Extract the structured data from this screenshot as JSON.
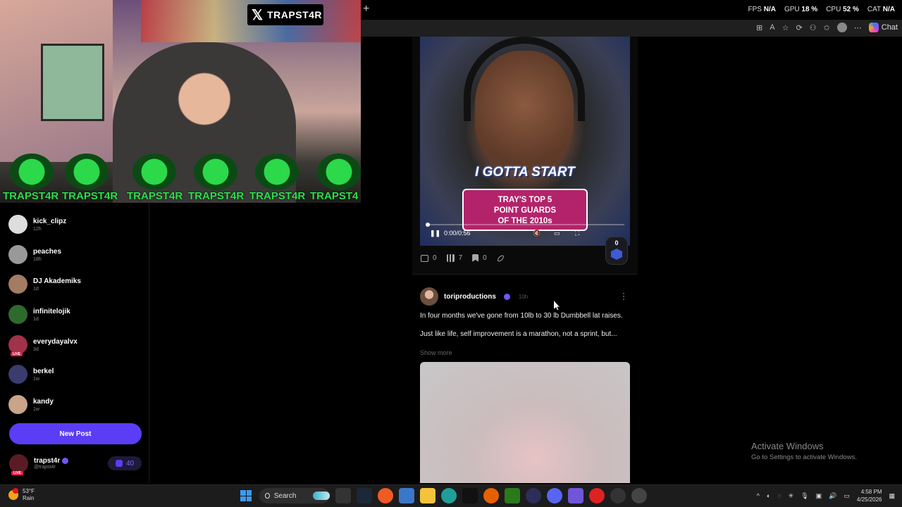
{
  "webcam": {
    "badge_text": "TRAPST4R",
    "tags": [
      "TRAPST4R",
      "TRAPST4R",
      "TRAPST4R",
      "TRAPST4R",
      "TRAPST4R",
      "TRAPST4"
    ]
  },
  "perf": {
    "fps_label": "FPS",
    "fps_value": "N/A",
    "gpu_label": "GPU",
    "gpu_value": "18 %",
    "cpu_label": "CPU",
    "cpu_value": "52 %",
    "cat_label": "CAT",
    "cat_value": "N/A"
  },
  "browser": {
    "chat_label": "Chat",
    "new_tab": "+"
  },
  "sidebar": {
    "users": [
      {
        "name": "kick_clipz",
        "ago": "12h",
        "live": false
      },
      {
        "name": "peaches",
        "ago": "18h",
        "live": false
      },
      {
        "name": "DJ Akademiks",
        "ago": "1d",
        "live": false
      },
      {
        "name": "infinitelojik",
        "ago": "1d",
        "live": false
      },
      {
        "name": "everydayalvx",
        "ago": "3d",
        "live": true
      },
      {
        "name": "berkel",
        "ago": "1w",
        "live": false
      },
      {
        "name": "kandy",
        "ago": "1w",
        "live": false
      }
    ],
    "live_label": "LIVE",
    "new_post": "New Post",
    "me": {
      "name": "trapst4r",
      "handle": "@trapst4r",
      "points": "40"
    }
  },
  "post1": {
    "caption": "I GOTTA START",
    "card_lines": [
      "TRAY'S TOP 5",
      "POINT GUARDS",
      "OF THE 2010s"
    ],
    "time": "0:00/0:56",
    "kick_count": "0",
    "comments": "0",
    "views": "7",
    "bookmarks": "0"
  },
  "post2": {
    "username": "toriproductions",
    "timestamp": "10h",
    "text_line1": "In four months we've gone from 10lb to 30 lb Dumbbell lat raises.",
    "text_line2": "Just like life, self improvement is a marathon, not a sprint, but...",
    "show_more": "Show more"
  },
  "watermark": {
    "title": "Activate Windows",
    "subtitle": "Go to Settings to activate Windows."
  },
  "taskbar": {
    "temp": "53°F",
    "condition": "Rain",
    "search": "Search",
    "time": "4:58 PM",
    "date": "4/25/2026"
  }
}
